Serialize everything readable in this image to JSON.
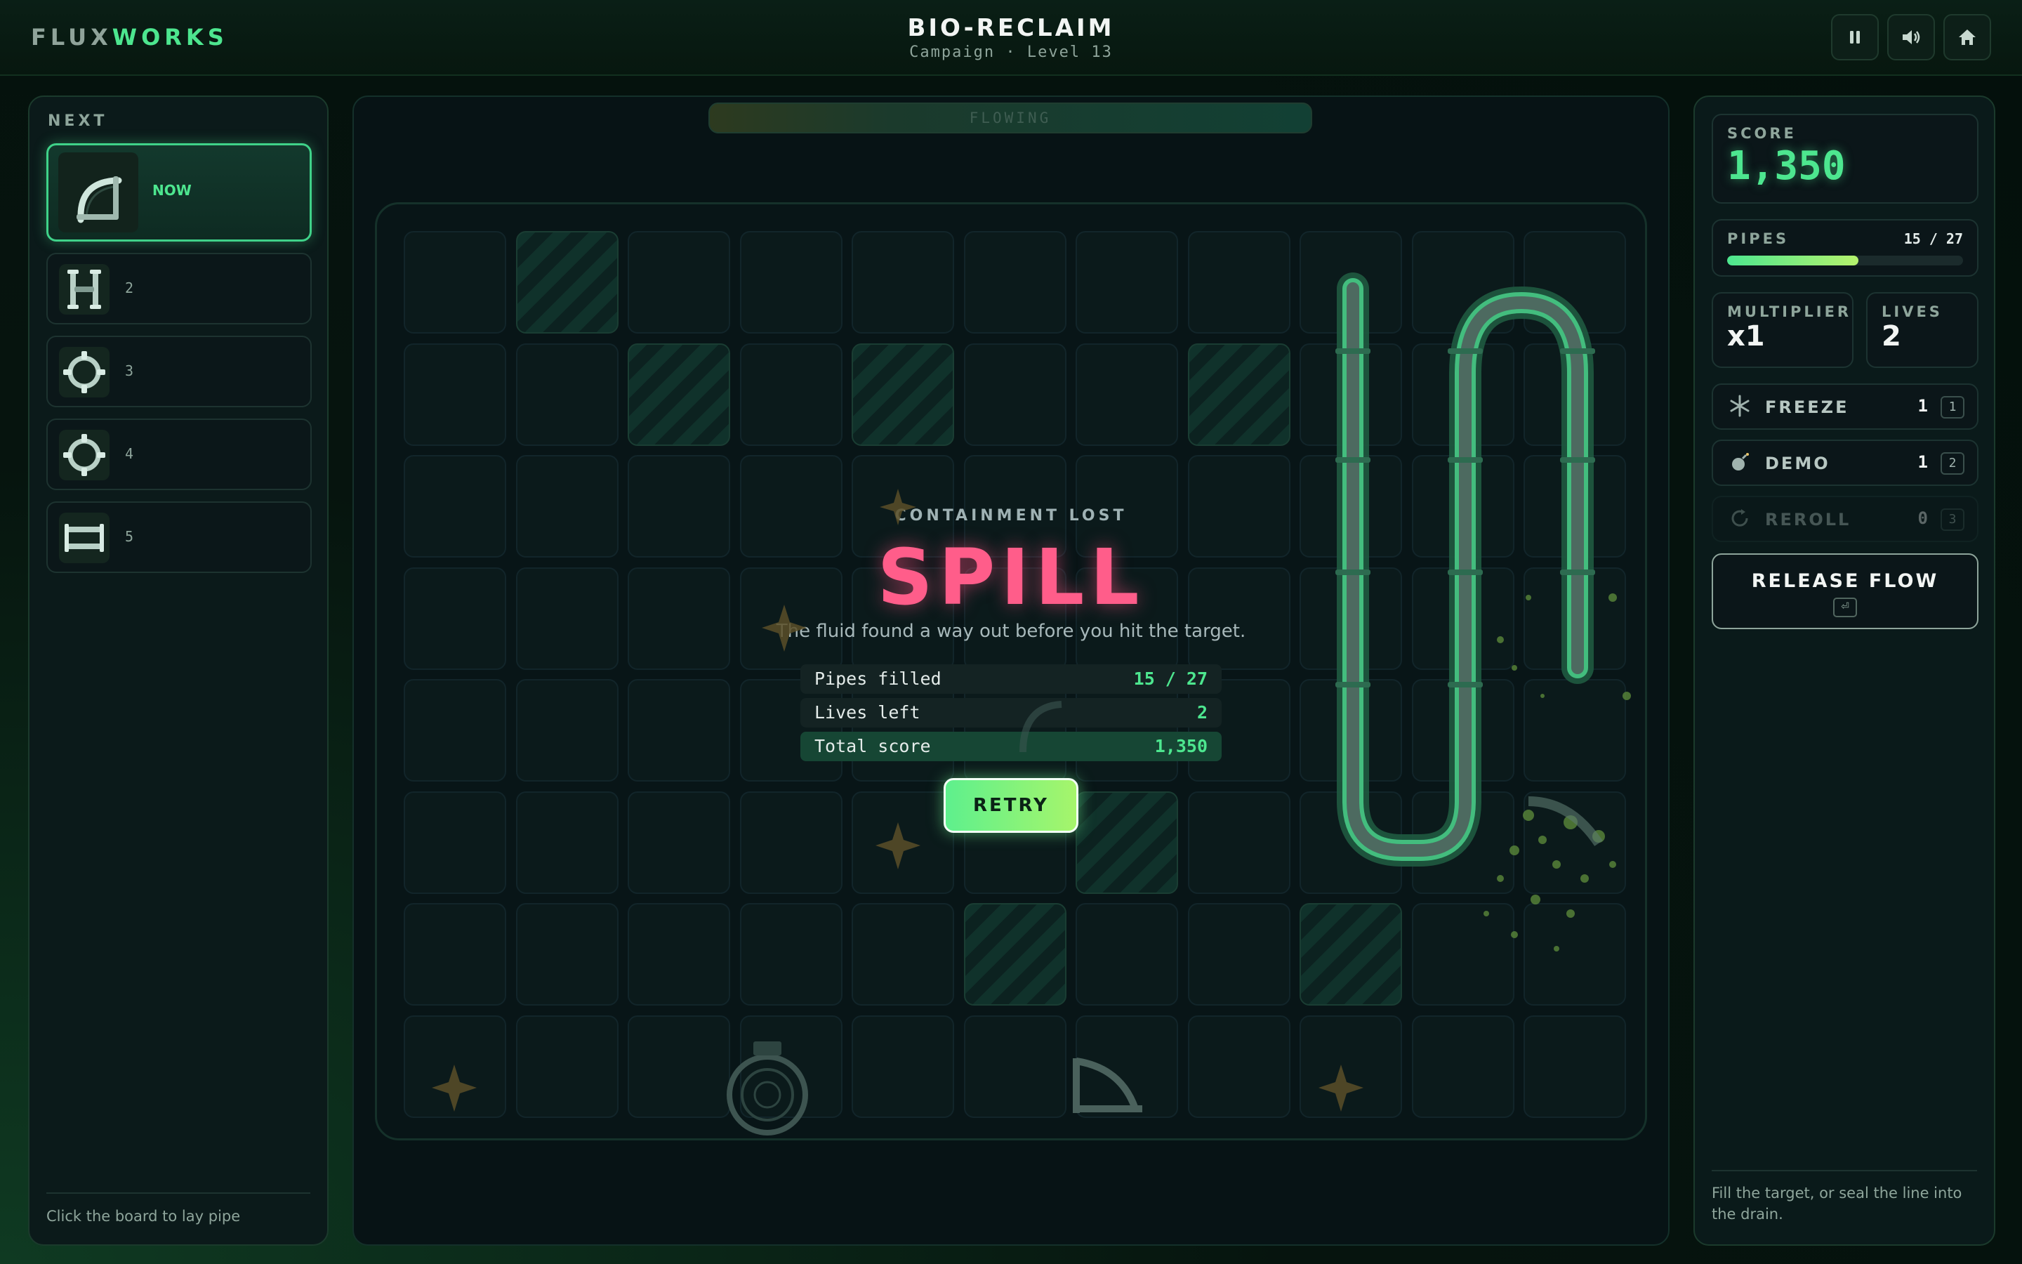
{
  "header": {
    "brand_a": "FLUX",
    "brand_b": "WORKS",
    "title": "BIO-RECLAIM",
    "subtitle": "Campaign · Level 13",
    "buttons": [
      {
        "name": "pause",
        "icon": "pause-icon"
      },
      {
        "name": "sound",
        "icon": "speaker-icon"
      },
      {
        "name": "home",
        "icon": "home-icon"
      }
    ]
  },
  "queue": {
    "label": "NEXT",
    "items": [
      {
        "label": "NOW",
        "piece": "elbow"
      },
      {
        "label": "2",
        "piece": "vertical-cross"
      },
      {
        "label": "3",
        "piece": "ring"
      },
      {
        "label": "4",
        "piece": "ring"
      },
      {
        "label": "5",
        "piece": "horizontal-cross"
      }
    ],
    "hint": "Click the board to lay pipe"
  },
  "board": {
    "status": "FLOWING",
    "cols": 11,
    "rows": 8,
    "blocked_cells": [
      [
        0,
        1
      ],
      [
        1,
        2
      ],
      [
        1,
        4
      ],
      [
        1,
        7
      ],
      [
        5,
        6
      ],
      [
        6,
        5
      ],
      [
        6,
        8
      ]
    ]
  },
  "overlay": {
    "kicker": "CONTAINMENT LOST",
    "title": "SPILL",
    "description": "The fluid found a way out before you hit the target.",
    "stats": [
      {
        "label": "Pipes filled",
        "value": "15 / 27"
      },
      {
        "label": "Lives left",
        "value": "2"
      },
      {
        "label": "Total score",
        "value": "1,350"
      }
    ],
    "retry_label": "RETRY"
  },
  "stats": {
    "score_label": "SCORE",
    "score": "1,350",
    "pipes_label": "PIPES",
    "pipes_value": "15 / 27",
    "pipes_fraction": 0.556,
    "multiplier_label": "MULTIPLIER",
    "multiplier": "x1",
    "lives_label": "LIVES",
    "lives": "2"
  },
  "powerups": [
    {
      "name": "FREEZE",
      "count": "1",
      "key": "1",
      "icon": "snowflake-icon",
      "disabled": false
    },
    {
      "name": "DEMO",
      "count": "1",
      "key": "2",
      "icon": "bomb-icon",
      "disabled": false
    },
    {
      "name": "REROLL",
      "count": "0",
      "key": "3",
      "icon": "reroll-icon",
      "disabled": true
    }
  ],
  "release": {
    "label": "RELEASE FLOW",
    "key": "⏎"
  },
  "right_hint": "Fill the target, or seal the line into the drain.",
  "colors": {
    "accent": "#4de68f",
    "spill": "#ff5d8a",
    "bar_end": "#b5f26d"
  }
}
